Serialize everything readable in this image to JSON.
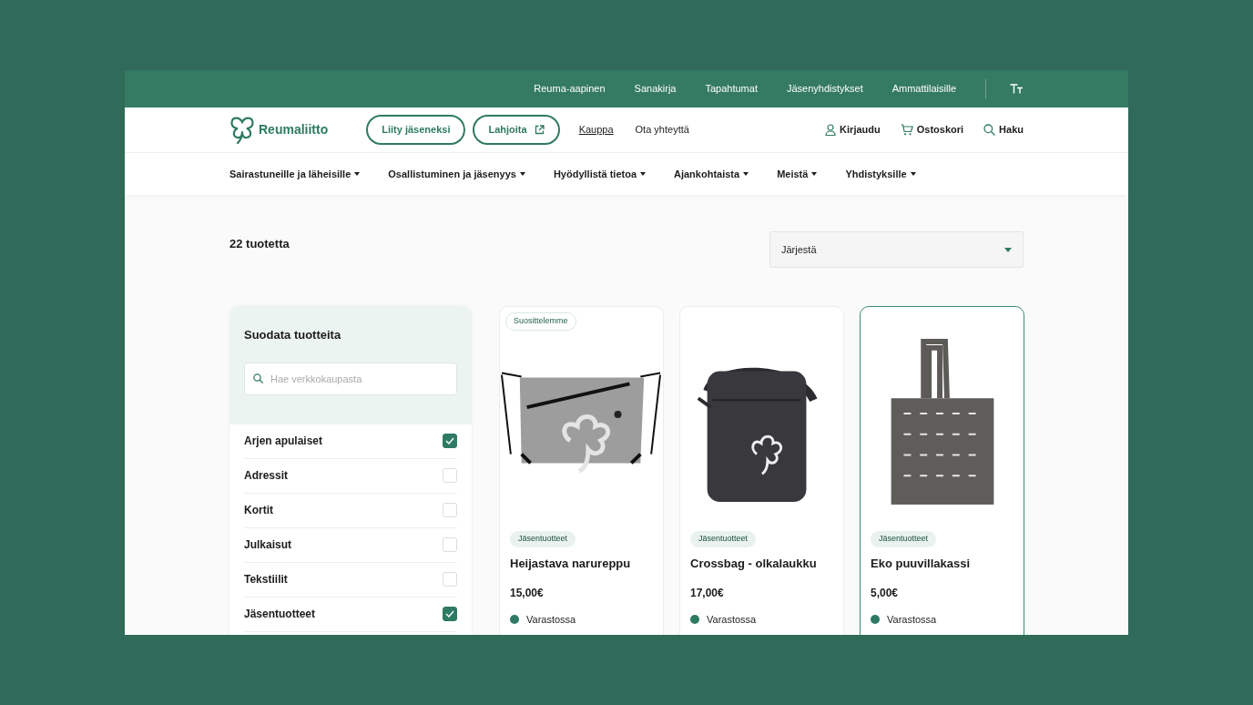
{
  "top_links": [
    "Reuma-aapinen",
    "Sanakirja",
    "Tapahtumat",
    "Jäsenyhdistykset",
    "Ammattilaisille"
  ],
  "logo": {
    "text": "Reumaliitto"
  },
  "header_buttons": [
    {
      "label": "Liity jäseneksi",
      "kind": "plain"
    },
    {
      "label": "Lahjoita",
      "kind": "external"
    }
  ],
  "header_links": [
    {
      "label": "Kauppa",
      "selected": true
    },
    {
      "label": "Ota yhteyttä",
      "selected": false
    }
  ],
  "user_links": [
    {
      "kind": "user",
      "label": "Kirjaudu"
    },
    {
      "kind": "cart",
      "label": "Ostoskori"
    },
    {
      "kind": "search",
      "label": "Haku"
    }
  ],
  "main_nav": [
    "Sairastuneille ja läheisille",
    "Osallistuminen ja jäsenyys",
    "Hyödyllistä tietoa",
    "Ajankohtaista",
    "Meistä",
    "Yhdistyksille"
  ],
  "product_count": "22 tuotetta",
  "sort": {
    "label": "Järjestä"
  },
  "filter": {
    "title": "Suodata tuotteita",
    "search": {
      "placeholder": "Hae verkkokaupasta"
    },
    "categories": [
      {
        "label": "Arjen apulaiset",
        "checked": true
      },
      {
        "label": "Adressit",
        "checked": false
      },
      {
        "label": "Kortit",
        "checked": false
      },
      {
        "label": "Julkaisut",
        "checked": false
      },
      {
        "label": "Tekstiilit",
        "checked": false
      },
      {
        "label": "Jäsentuotteet",
        "checked": true
      }
    ]
  },
  "products": [
    {
      "kind": "drawstring",
      "badge": "Suosittelemme",
      "category": "Jäsentuotteet",
      "name": "Heijastava narureppu",
      "price": "15,00€",
      "stock": "Varastossa",
      "highlighted": false
    },
    {
      "kind": "crossbag",
      "category": "Jäsentuotteet",
      "name": "Crossbag - olkalaukku",
      "price": "17,00€",
      "stock": "Varastossa",
      "highlighted": false
    },
    {
      "kind": "tote",
      "category": "Jäsentuotteet",
      "name": "Eko puuvillakassi",
      "price": "5,00€",
      "stock": "Varastossa",
      "highlighted": true
    }
  ]
}
